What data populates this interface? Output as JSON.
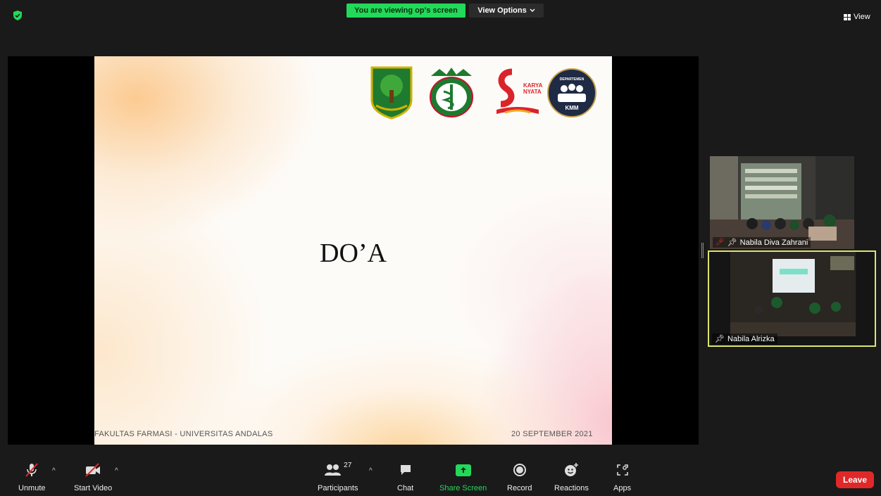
{
  "top": {
    "viewing_banner": "You are viewing op's screen",
    "view_options": "View Options",
    "view_label": "View"
  },
  "slide": {
    "title": "DO’A",
    "footer_left": "FAKULTAS FARMASI - UNIVERSITAS ANDALAS",
    "footer_right": "20 SEPTEMBER 2021",
    "logo_texts": [
      "KARYA",
      "NYATA",
      "DEPARTEMEN",
      "KMM"
    ]
  },
  "participants": [
    {
      "name": "Nabila Diva Zahrani",
      "muted": true,
      "pinned": true
    },
    {
      "name": "Nabila Alrizka",
      "muted": false,
      "pinned": true,
      "active_speaker": true
    }
  ],
  "toolbar": {
    "unmute": "Unmute",
    "start_video": "Start Video",
    "participants": "Participants",
    "participant_count": "27",
    "chat": "Chat",
    "share_screen": "Share Screen",
    "record": "Record",
    "reactions": "Reactions",
    "apps": "Apps",
    "leave": "Leave"
  },
  "colors": {
    "share_green": "#23d959",
    "leave_red": "#e02828",
    "speaker_border": "#dce56e"
  }
}
